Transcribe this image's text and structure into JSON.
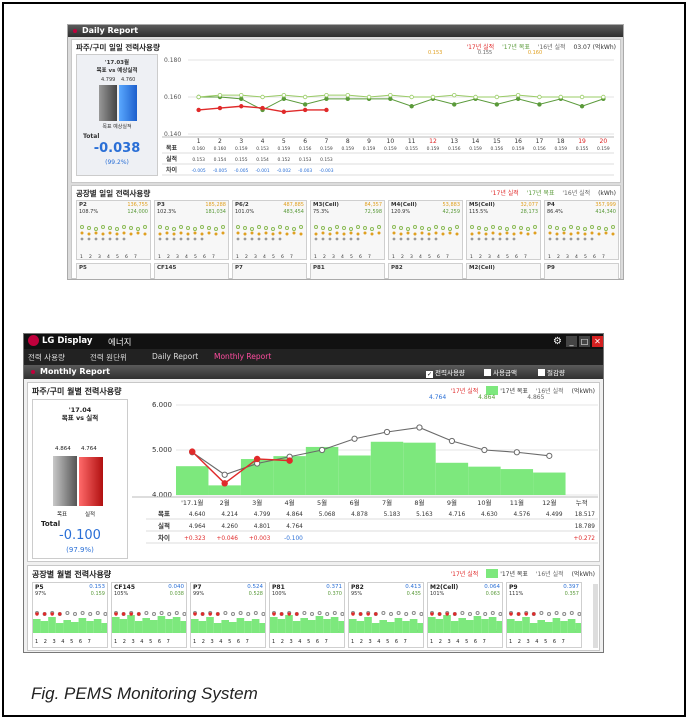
{
  "caption": "Fig. PEMS Monitoring System",
  "colors": {
    "accent": "#c0003c",
    "target": "#7de87d",
    "actual": "#e02a2a",
    "prev": "#6a6a6a",
    "blue": "#2a6fd6"
  },
  "daily": {
    "header": "Daily Report",
    "title": "파주/구미 일일 전력사용량",
    "legend": {
      "actual17": "'17년 실적",
      "target17": "'17년 목표",
      "actual16": "'16년 실적",
      "unit": "03.07 (억kWh)",
      "v1": "0.153",
      "v2": "0.155",
      "v3": "0.160"
    },
    "summary": {
      "title": "'17.03월\n목표 vs 예상실적",
      "target": "4.799",
      "forecast": "4.760",
      "bar_label": "목표 예상실적",
      "total_label": "Total",
      "total": "-0.038",
      "pct": "(99.2%)"
    },
    "table": {
      "row_labels": [
        "목표",
        "실적",
        "차이"
      ],
      "days": [
        "1",
        "2",
        "3",
        "4",
        "5",
        "6",
        "7",
        "8",
        "9",
        "10",
        "11",
        "12",
        "13",
        "14",
        "15",
        "16",
        "17",
        "18",
        "19",
        "20"
      ],
      "target": [
        "0.160",
        "0.160",
        "0.159",
        "0.153",
        "0.159",
        "0.156",
        "0.159",
        "0.159",
        "0.159",
        "0.159",
        "0.155",
        "0.159",
        "0.156",
        "0.159",
        "0.156",
        "0.159",
        "0.156",
        "0.159",
        "0.155",
        "0.159"
      ],
      "actual": [
        "0.153",
        "0.154",
        "0.155",
        "0.154",
        "0.152",
        "0.153",
        "0.153",
        "",
        "",
        "",
        "",
        "",
        "",
        "",
        "",
        "",
        "",
        "",
        "",
        ""
      ],
      "diff": [
        "-0.005",
        "-0.005",
        "-0.005",
        "-0.001",
        "-0.002",
        "-0.003",
        "-0.003",
        "",
        "",
        "",
        "",
        "",
        "",
        "",
        "",
        "",
        "",
        "",
        "",
        ""
      ]
    },
    "ylim_ticks": [
      "0.180",
      "0.160",
      "0.140"
    ],
    "factory_title": "공장별 일일 전력사용량",
    "factory_legend": {
      "actual17": "'17년 실적",
      "target17": "'17년 목표",
      "actual16": "'16년 실적",
      "unit": "(kWh)"
    },
    "factories": [
      {
        "name": "P2",
        "val": "136,755",
        "pct": "108.7%",
        "goal": "124,000"
      },
      {
        "name": "P3",
        "val": "185,288",
        "pct": "102.3%",
        "goal": "181,034"
      },
      {
        "name": "P6/2",
        "val": "487,885",
        "pct": "101.0%",
        "goal": "483,454"
      },
      {
        "name": "M3(Cell)",
        "val": "84,357",
        "pct": "75.3%",
        "goal": "72,598"
      },
      {
        "name": "M4(Cell)",
        "val": "53,883",
        "pct": "120.9%",
        "goal": "42,259"
      },
      {
        "name": "M5(Cell)",
        "val": "32,077",
        "pct": "115.5%",
        "goal": "28,173"
      },
      {
        "name": "P4",
        "val": "357,999",
        "pct": "86.4%",
        "goal": "414,340"
      }
    ],
    "factories_row2": [
      "P5",
      "CF145",
      "P7",
      "P81",
      "P82",
      "M2(Cell)",
      "P9"
    ]
  },
  "lg": {
    "brand": "LG Display",
    "app": "에너지",
    "menu": [
      "전력 사용량",
      "전력 원단위",
      "Daily Report",
      "Monthly Report"
    ],
    "report_header": "Monthly Report",
    "checkboxes": [
      "전력사용량",
      "사용금액",
      "절감량"
    ],
    "monthly_title": "파주/구미 월별 전력사용량",
    "legend": {
      "actual17": "'17년 실적",
      "target17": "'17년 목표",
      "actual16": "'16년 실적",
      "unit": "(억kWh)",
      "v1": "4.764",
      "v2": "4.864",
      "v3": "4.865"
    },
    "summary": {
      "title": "'17.04\n목표 vs 실적",
      "target": "4.864",
      "actual": "4.764",
      "bar_label_t": "목표",
      "bar_label_a": "실적",
      "total_label": "Total",
      "total": "-0.100",
      "pct": "(97.9%)"
    },
    "yticks": [
      "6.000",
      "5.000",
      "4.000"
    ],
    "months": [
      "'17.1월",
      "2월",
      "3월",
      "4월",
      "5월",
      "6월",
      "7월",
      "8월",
      "9월",
      "10월",
      "11월",
      "12월",
      "누적"
    ],
    "row_labels": [
      "목표",
      "실적",
      "차이"
    ],
    "target_row": [
      "4.640",
      "4.214",
      "4.799",
      "4.864",
      "5.068",
      "4.878",
      "5.183",
      "5.163",
      "4.716",
      "4.630",
      "4.576",
      "4.499",
      "18.517"
    ],
    "actual_row": [
      "4.964",
      "4.260",
      "4.801",
      "4.764",
      "",
      "",
      "",
      "",
      "",
      "",
      "",
      "",
      "18.789"
    ],
    "diff_row": [
      "+0.323",
      "+0.046",
      "+0.003",
      "-0.100",
      "",
      "",
      "",
      "",
      "",
      "",
      "",
      "",
      "+0.272"
    ],
    "factory_title": "공장별 월별 전력사용량",
    "factory_legend": {
      "actual17": "'17년 실적",
      "target17": "'17년 목표",
      "actual16": "'16년 실적",
      "unit": "(억kWh)"
    },
    "factories": [
      {
        "name": "P5",
        "val": "0.153",
        "pct": "97%",
        "goal": "0.159",
        "low": "0.164"
      },
      {
        "name": "CF145",
        "val": "0.040",
        "pct": "105%",
        "goal": "0.038",
        "low": "0.048"
      },
      {
        "name": "P7",
        "val": "0.524",
        "pct": "99%",
        "goal": "0.528",
        "low": "0.511"
      },
      {
        "name": "P81",
        "val": "0.371",
        "pct": "100%",
        "goal": "0.370",
        "low": "0.367"
      },
      {
        "name": "P82",
        "val": "0.413",
        "pct": "95%",
        "goal": "0.435",
        "low": "0.409"
      },
      {
        "name": "M2(Cell)",
        "val": "0.064",
        "pct": "101%",
        "goal": "0.063",
        "low": "0.060"
      },
      {
        "name": "P9",
        "val": "0.397",
        "pct": "111%",
        "goal": "0.357",
        "low": "0.385"
      }
    ],
    "mini_ticks": "1 2 3 4 5 6 7"
  },
  "chart_data": [
    {
      "type": "line",
      "title": "파주/구미 일일 전력사용량",
      "x": [
        1,
        2,
        3,
        4,
        5,
        6,
        7,
        8,
        9,
        10,
        11,
        12,
        13,
        14,
        15,
        16,
        17,
        18,
        19,
        20
      ],
      "ylim": [
        0.14,
        0.18
      ],
      "series": [
        {
          "name": "'17년 목표",
          "values": [
            0.16,
            0.16,
            0.159,
            0.153,
            0.159,
            0.156,
            0.159,
            0.159,
            0.159,
            0.159,
            0.155,
            0.159,
            0.156,
            0.159,
            0.156,
            0.159,
            0.156,
            0.159,
            0.155,
            0.159
          ]
        },
        {
          "name": "'17년 실적",
          "values": [
            0.153,
            0.154,
            0.155,
            0.154,
            0.152,
            0.153,
            0.153
          ]
        },
        {
          "name": "'16년 실적",
          "values": [
            0.16,
            0.161,
            0.161,
            0.16,
            0.161,
            0.16,
            0.161,
            0.161,
            0.16,
            0.161,
            0.16,
            0.16,
            0.161,
            0.16,
            0.16,
            0.161,
            0.16,
            0.16,
            0.16,
            0.16
          ]
        }
      ]
    },
    {
      "type": "bar",
      "title": "파주/구미 월별 전력사용량",
      "categories": [
        "'17.1월",
        "2월",
        "3월",
        "4월",
        "5월",
        "6월",
        "7월",
        "8월",
        "9월",
        "10월",
        "11월",
        "12월"
      ],
      "ylim": [
        4.0,
        6.0
      ],
      "series": [
        {
          "name": "'17년 목표",
          "values": [
            4.64,
            4.214,
            4.799,
            4.864,
            5.068,
            4.878,
            5.183,
            5.163,
            4.716,
            4.63,
            4.576,
            4.499
          ]
        },
        {
          "name": "'17년 실적",
          "values": [
            4.964,
            4.26,
            4.801,
            4.764
          ]
        },
        {
          "name": "'16년 실적",
          "values": [
            4.95,
            4.45,
            4.7,
            4.85,
            5.0,
            5.25,
            5.4,
            5.5,
            5.2,
            5.0,
            4.95,
            4.87
          ]
        }
      ]
    }
  ]
}
